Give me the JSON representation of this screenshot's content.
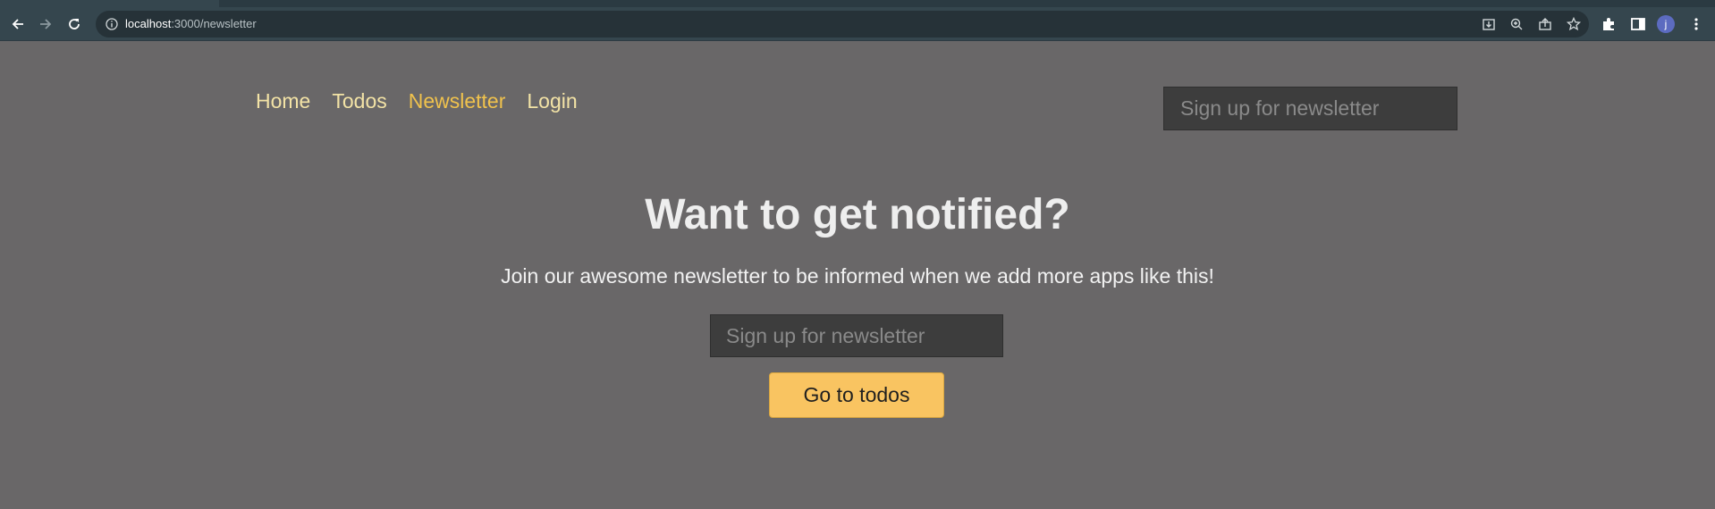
{
  "browser": {
    "url_host": "localhost",
    "url_rest": ":3000/newsletter",
    "profile_initial": "j"
  },
  "nav": {
    "links": [
      {
        "label": "Home",
        "active": false
      },
      {
        "label": "Todos",
        "active": false
      },
      {
        "label": "Newsletter",
        "active": true
      },
      {
        "label": "Login",
        "active": false
      }
    ],
    "signup_placeholder": "Sign up for newsletter"
  },
  "main": {
    "headline": "Want to get notified?",
    "subtext": "Join our awesome newsletter to be informed when we add more apps like this!",
    "signup_placeholder": "Sign up for newsletter",
    "cta_label": "Go to todos"
  },
  "colors": {
    "page_bg": "#696768",
    "nav_link": "#f3e3a6",
    "nav_link_active": "#f0c24d",
    "cta_bg": "#f9c461",
    "input_bg": "#3d3d3d",
    "toolbar_bg": "#35464e"
  },
  "icons": {
    "back": "arrow-left-icon",
    "forward": "arrow-right-icon",
    "reload": "reload-icon",
    "site_info": "info-circle-icon",
    "install": "install-icon",
    "zoom": "zoom-icon",
    "share": "share-icon",
    "bookmark": "star-icon",
    "extensions": "puzzle-icon",
    "side_panel": "side-panel-icon",
    "menu": "kebab-menu-icon"
  }
}
